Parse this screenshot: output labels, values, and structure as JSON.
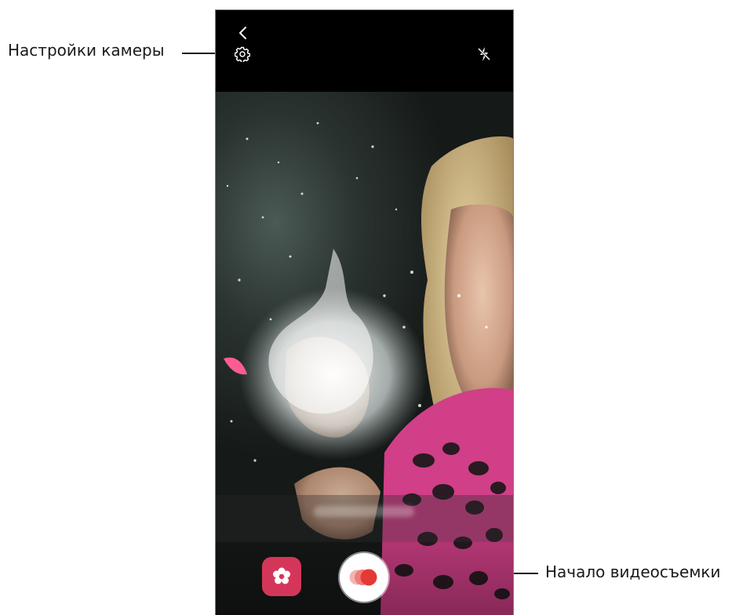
{
  "callouts": {
    "settings_label": "Настройки камеры",
    "record_label": "Начало видеосъемки"
  },
  "camera": {
    "icons": {
      "back": "chevron-left-icon",
      "settings": "gear-icon",
      "flash": "flash-off-icon",
      "effect": "flower-icon",
      "record": "super-slow-mo-record-icon"
    },
    "hint_text": "",
    "colors": {
      "effect_button": "#d4365a",
      "record_dot": "#e53935",
      "background": "#000000"
    }
  }
}
